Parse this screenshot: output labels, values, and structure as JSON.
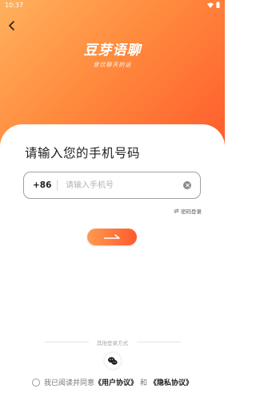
{
  "status_bar": {
    "time": "10:37"
  },
  "logo": {
    "title": "豆芽语聊",
    "subtitle": "音饮聊天的运"
  },
  "login": {
    "title": "请输入您的手机号码",
    "country_code": "+86",
    "phone_placeholder": "请输入手机号",
    "password_login_label": "密码登录"
  },
  "other_login": {
    "label": "其他登录方式"
  },
  "agreement": {
    "prefix": "我已阅读并同意",
    "user_agreement": "《用户协议》",
    "and": "和",
    "privacy_policy": "《隐私协议》"
  },
  "colors": {
    "gradient_start": "#ffb15c",
    "gradient_end": "#ff5a2c",
    "wechat_green": "#27c25f"
  }
}
